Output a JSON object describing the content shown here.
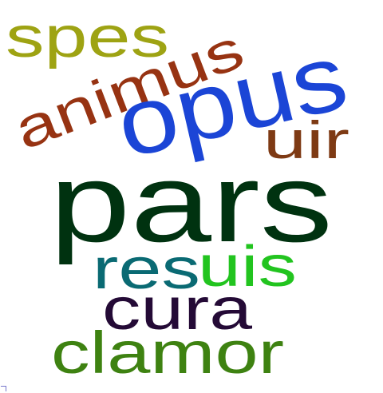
{
  "words": [
    {
      "text": "spes",
      "color": "#9ea313"
    },
    {
      "text": "animus",
      "color": "#973312"
    },
    {
      "text": "opus",
      "color": "#1b45d6"
    },
    {
      "text": "uir",
      "color": "#7e3a14"
    },
    {
      "text": "pars",
      "color": "#003210"
    },
    {
      "text": "res",
      "color": "#0a6a73"
    },
    {
      "text": "uis",
      "color": "#22c41f"
    },
    {
      "text": "cura",
      "color": "#240a36"
    },
    {
      "text": "clamor",
      "color": "#3e8211"
    }
  ]
}
